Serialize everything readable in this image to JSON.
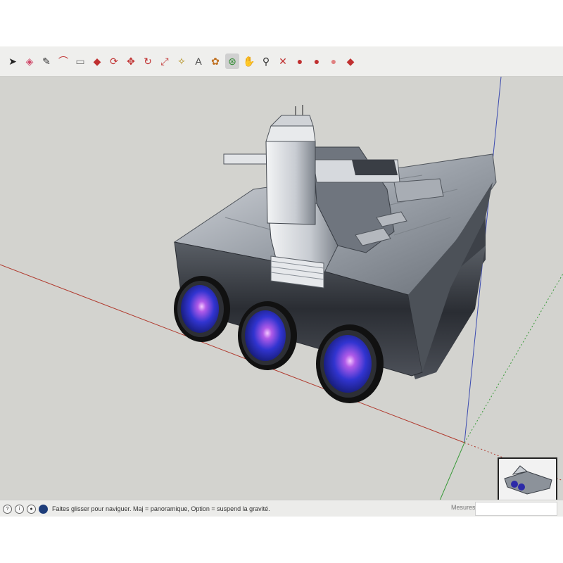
{
  "toolbar": {
    "tools": [
      {
        "id": "select",
        "icon": "arrow-select-icon",
        "glyph": "➤",
        "color": "#222222"
      },
      {
        "id": "eraser",
        "icon": "eraser-icon",
        "glyph": "◈",
        "color": "#d04a6a"
      },
      {
        "id": "line",
        "icon": "pencil-line-icon",
        "glyph": "✎",
        "color": "#333333"
      },
      {
        "id": "arc",
        "icon": "arc-icon",
        "glyph": "⌒",
        "color": "#c03030"
      },
      {
        "id": "rectangle",
        "icon": "rectangle-icon",
        "glyph": "▭",
        "color": "#777777"
      },
      {
        "id": "push-pull",
        "icon": "push-pull-icon",
        "glyph": "◆",
        "color": "#c03030"
      },
      {
        "id": "offset",
        "icon": "offset-icon",
        "glyph": "⟳",
        "color": "#c03030"
      },
      {
        "id": "move",
        "icon": "move-icon",
        "glyph": "✥",
        "color": "#c03030"
      },
      {
        "id": "rotate",
        "icon": "rotate-icon",
        "glyph": "↻",
        "color": "#c03030"
      },
      {
        "id": "scale",
        "icon": "scale-icon",
        "glyph": "⤢",
        "color": "#c03030"
      },
      {
        "id": "tape",
        "icon": "tape-measure-icon",
        "glyph": "✧",
        "color": "#b08a10"
      },
      {
        "id": "text",
        "icon": "text-label-icon",
        "glyph": "A",
        "color": "#444444"
      },
      {
        "id": "paint",
        "icon": "paint-bucket-icon",
        "glyph": "✿",
        "color": "#c07020"
      },
      {
        "id": "orbit",
        "icon": "orbit-icon",
        "glyph": "⊛",
        "color": "#2e8a2e"
      },
      {
        "id": "pan",
        "icon": "pan-hand-icon",
        "glyph": "✋",
        "color": "#c09020"
      },
      {
        "id": "zoom",
        "icon": "zoom-icon",
        "glyph": "⚲",
        "color": "#333333"
      },
      {
        "id": "zoom-extents",
        "icon": "zoom-extents-icon",
        "glyph": "✕",
        "color": "#c03030"
      },
      {
        "id": "warehouse",
        "icon": "3d-warehouse-icon",
        "glyph": "●",
        "color": "#c03030"
      },
      {
        "id": "extension",
        "icon": "extension-warehouse-icon",
        "glyph": "●",
        "color": "#c03030"
      },
      {
        "id": "layout",
        "icon": "send-to-layout-icon",
        "glyph": "●",
        "color": "#e08080"
      },
      {
        "id": "ruby",
        "icon": "ruby-console-icon",
        "glyph": "◆",
        "color": "#c03030"
      }
    ]
  },
  "statusbar": {
    "hint": "Faites glisser pour naviguer. Maj = panoramique, Option = suspend la gravité.",
    "measures_label": "Mesures",
    "measures_value": "",
    "icons": [
      "info-icon",
      "credits-icon",
      "user-icon",
      "geolocation-icon"
    ]
  },
  "scene": {
    "axis_colors": {
      "red": "#b03a2e",
      "green": "#3a9a3a",
      "blue": "#3a4ab0"
    },
    "thruster_color": "#2d2aa8"
  }
}
